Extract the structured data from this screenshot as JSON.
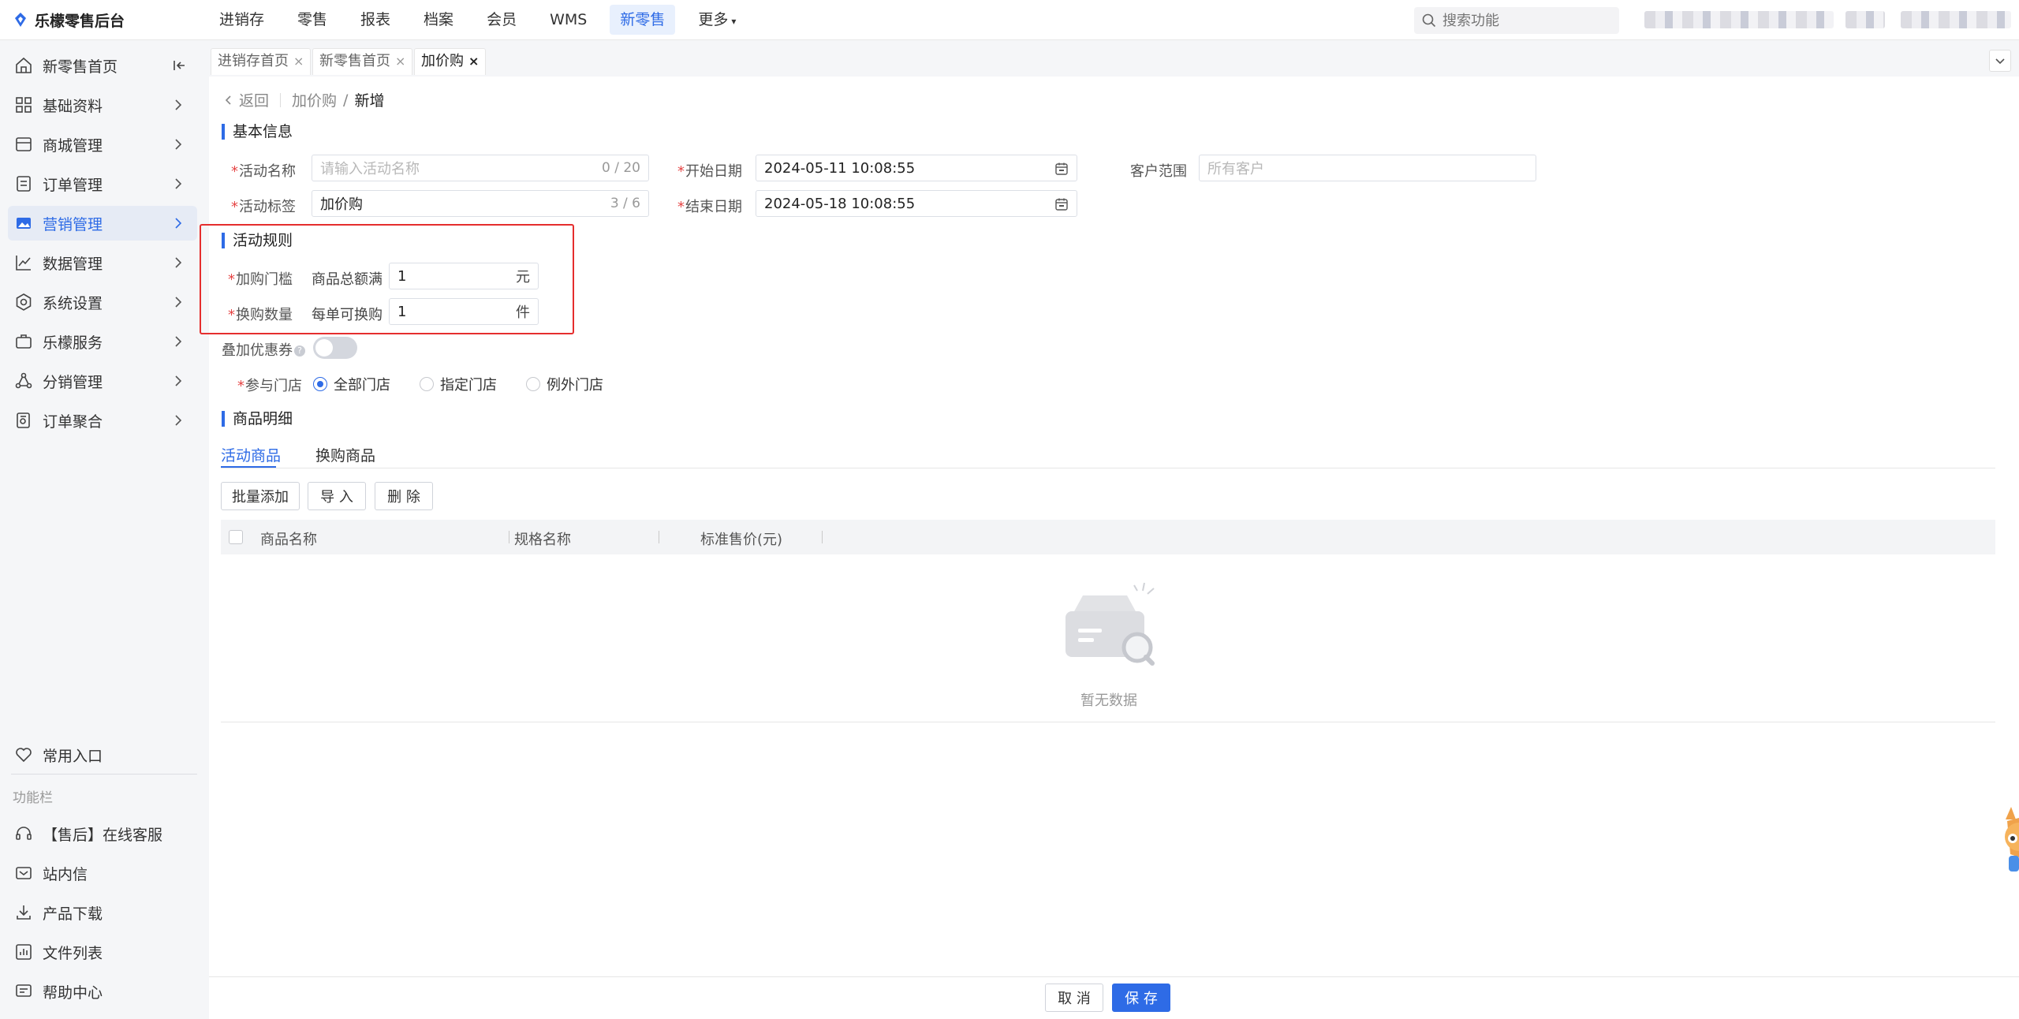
{
  "app": {
    "title": "乐檬零售后台"
  },
  "topnav": {
    "items": [
      "进销存",
      "零售",
      "报表",
      "档案",
      "会员",
      "WMS",
      "新零售",
      "更多"
    ],
    "active_index": 6
  },
  "search": {
    "placeholder": "搜索功能"
  },
  "sidebar": {
    "items": [
      {
        "label": "新零售首页",
        "icon": "home-icon"
      },
      {
        "label": "基础资料",
        "icon": "grid-icon"
      },
      {
        "label": "商城管理",
        "icon": "shop-icon"
      },
      {
        "label": "订单管理",
        "icon": "document-icon"
      },
      {
        "label": "营销管理",
        "icon": "image-icon",
        "active": true
      },
      {
        "label": "数据管理",
        "icon": "chart-line-icon"
      },
      {
        "label": "系统设置",
        "icon": "settings-icon"
      },
      {
        "label": "乐檬服务",
        "icon": "briefcase-icon"
      },
      {
        "label": "分销管理",
        "icon": "network-icon"
      },
      {
        "label": "订单聚合",
        "icon": "order-aggregate-icon"
      }
    ],
    "favorites_label": "常用入口",
    "function_bar_label": "功能栏",
    "function_items": [
      {
        "label": "【售后】在线客服",
        "icon": "headset-icon"
      },
      {
        "label": "站内信",
        "icon": "mail-icon"
      },
      {
        "label": "产品下载",
        "icon": "download-icon"
      },
      {
        "label": "文件列表",
        "icon": "file-list-icon"
      },
      {
        "label": "帮助中心",
        "icon": "help-chat-icon"
      }
    ]
  },
  "tabs": [
    {
      "label": "进销存首页",
      "close": "×"
    },
    {
      "label": "新零售首页",
      "close": "×"
    },
    {
      "label": "加价购",
      "close": "×",
      "active": true
    }
  ],
  "breadcrumb": {
    "back": "返回",
    "parent": "加价购",
    "separator": "/",
    "current": "新增"
  },
  "basic_info": {
    "title": "基本信息",
    "activity_name": {
      "label": "活动名称",
      "placeholder": "请输入活动名称",
      "count": "0 / 20"
    },
    "activity_tag": {
      "label": "活动标签",
      "value": "加价购",
      "count": "3 / 6"
    },
    "start_date": {
      "label": "开始日期",
      "value": "2024-05-11 10:08:55"
    },
    "end_date": {
      "label": "结束日期",
      "value": "2024-05-18 10:08:55"
    },
    "customer_scope": {
      "label": "客户范围",
      "placeholder": "所有客户"
    }
  },
  "rules": {
    "title": "活动规则",
    "threshold": {
      "label": "加购门槛",
      "sublabel": "商品总额满",
      "value": "1",
      "unit": "元"
    },
    "quantity": {
      "label": "换购数量",
      "sublabel": "每单可换购",
      "value": "1",
      "unit": "件"
    }
  },
  "stack_coupon": {
    "label": "叠加优惠券",
    "help": "?",
    "enabled": false
  },
  "stores": {
    "label": "参与门店",
    "options": [
      "全部门店",
      "指定门店",
      "例外门店"
    ],
    "selected_index": 0
  },
  "goods": {
    "title": "商品明细",
    "subtabs": [
      "活动商品",
      "换购商品"
    ],
    "active_subtab": 0,
    "buttons": {
      "batch_add": "批量添加",
      "import": "导 入",
      "delete": "删 除"
    },
    "columns": [
      "商品名称",
      "规格名称",
      "标准售价(元)"
    ],
    "rows": [],
    "empty_text": "暂无数据"
  },
  "footer": {
    "cancel": "取 消",
    "save": "保 存"
  },
  "colors": {
    "primary": "#2e6be6",
    "highlight_border": "#e52e2e",
    "required": "#e54545"
  }
}
